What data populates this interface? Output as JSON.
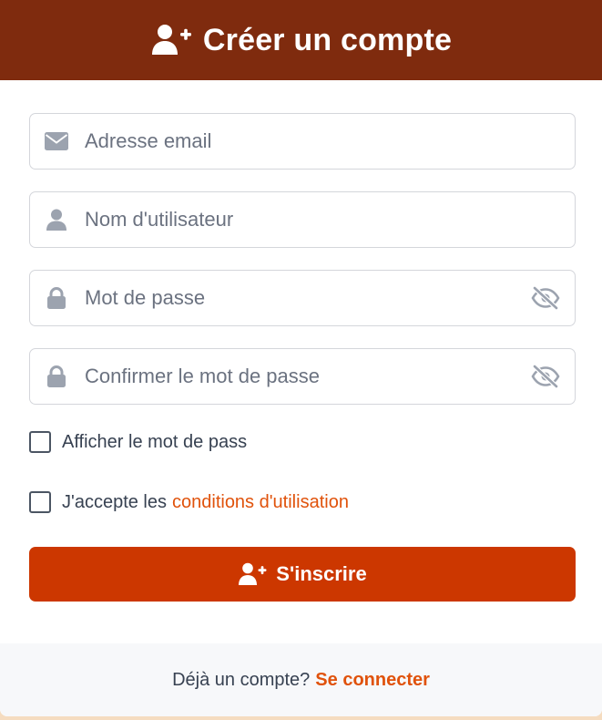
{
  "header": {
    "title": "Créer un compte",
    "icon": "user-plus-icon",
    "background": "#7f2b0e"
  },
  "fields": [
    {
      "icon": "envelope-icon",
      "placeholder": "Adresse email",
      "value": ""
    },
    {
      "icon": "user-icon",
      "placeholder": "Nom d'utilisateur",
      "value": ""
    },
    {
      "icon": "lock-icon",
      "placeholder": "Mot de passe",
      "value": "",
      "toggle_icon": "eye-slash-icon"
    },
    {
      "icon": "lock-icon",
      "placeholder": "Confirmer le mot de passe",
      "value": "",
      "toggle_icon": "eye-slash-icon"
    }
  ],
  "show_password": {
    "label": "Afficher le mot de pass",
    "checked": false
  },
  "terms": {
    "prefix": "J'accepte les",
    "link": "conditions d'utilisation",
    "checked": false
  },
  "submit": {
    "label": "S'inscrire",
    "icon": "user-plus-icon",
    "background": "#cc3700"
  },
  "footer": {
    "text": "Déjà un compte?",
    "link": "Se connecter"
  },
  "colors": {
    "accent": "#e0520b",
    "icon_gray": "#9ca3af"
  }
}
